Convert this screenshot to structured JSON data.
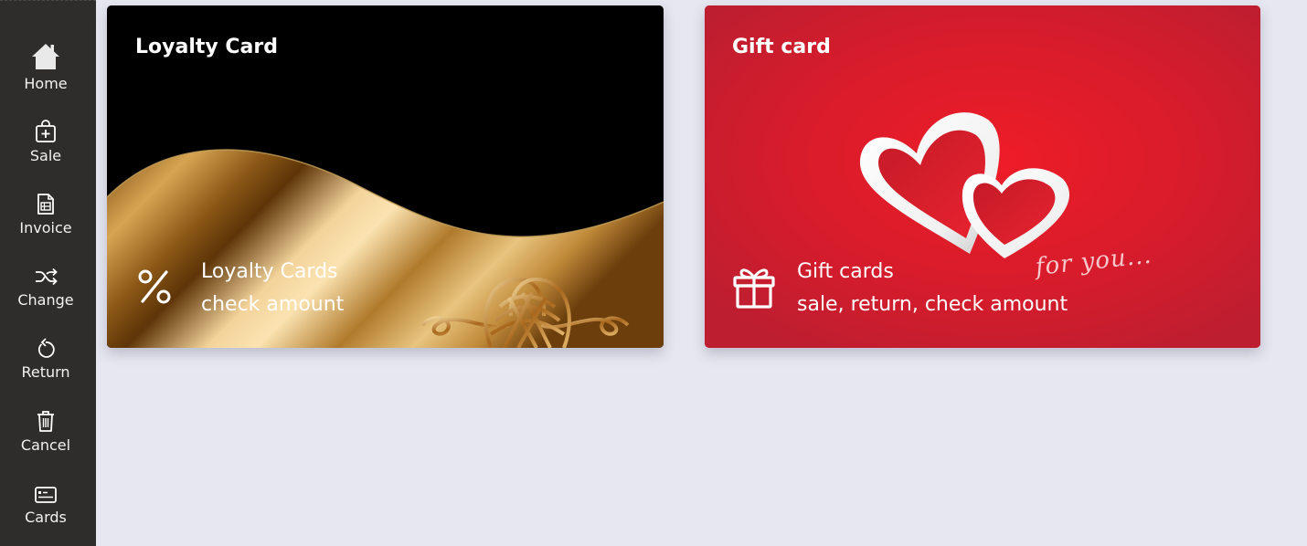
{
  "sidebar": {
    "items": [
      {
        "label": "Home",
        "icon": "home-icon"
      },
      {
        "label": "Sale",
        "icon": "shopping-bag-plus-icon"
      },
      {
        "label": "Invoice",
        "icon": "invoice-document-icon"
      },
      {
        "label": "Change",
        "icon": "shuffle-icon"
      },
      {
        "label": "Return",
        "icon": "undo-icon"
      },
      {
        "label": "Cancel",
        "icon": "trash-icon"
      },
      {
        "label": "Cards",
        "icon": "card-icon"
      }
    ]
  },
  "cards": {
    "loyalty": {
      "title": "Loyalty Card",
      "line1": "Loyalty Cards",
      "line2": "check amount",
      "icon": "percent-icon"
    },
    "gift": {
      "title": "Gift card",
      "line1": "Gift cards",
      "line2": "sale, return, check amount",
      "icon": "gift-icon",
      "decoration_text": "for you..."
    }
  },
  "colors": {
    "sidebar_bg": "#2e2d2b",
    "page_bg": "#e6e7f0",
    "gift_red": "#d91f2c",
    "gold": "#c9962a"
  }
}
